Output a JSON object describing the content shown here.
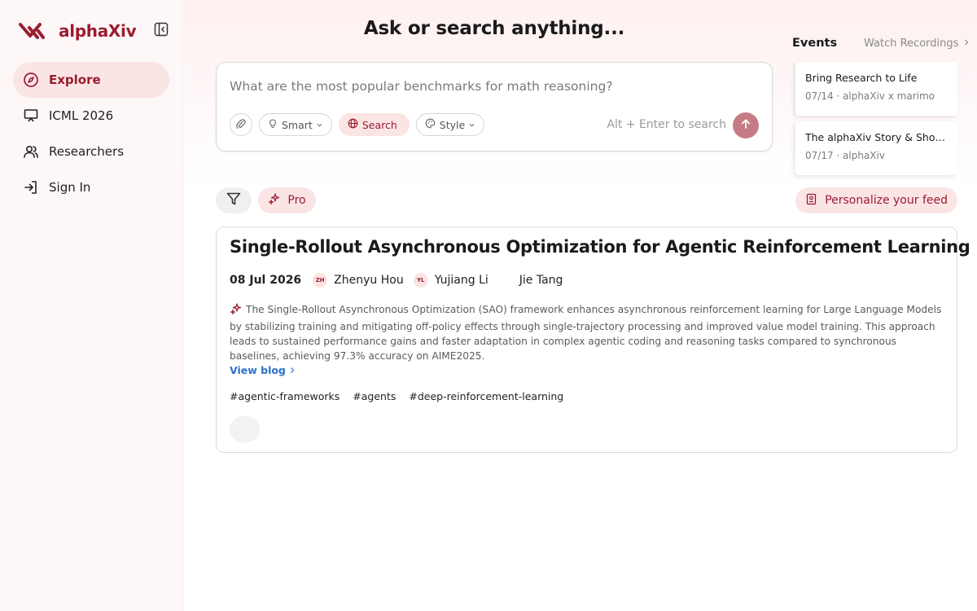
{
  "brand": {
    "name": "alphaXiv",
    "accent": "#9b1c31"
  },
  "sidebar": {
    "items": [
      {
        "label": "Explore",
        "icon": "compass-icon",
        "active": true
      },
      {
        "label": "ICML 2026",
        "icon": "presentation-icon"
      },
      {
        "label": "Researchers",
        "icon": "users-icon"
      },
      {
        "label": "Sign In",
        "icon": "sign-in-icon"
      }
    ]
  },
  "headline": "Ask or search anything...",
  "search": {
    "placeholder": "What are the most popular benchmarks for math reasoning?",
    "smart_label": "Smart",
    "search_label": "Search",
    "style_label": "Style",
    "hint": "Alt + Enter to search"
  },
  "events": {
    "title": "Events",
    "link_label": "Watch Recordings",
    "items": [
      {
        "title": "Bring Research to Life",
        "meta": "07/14 · alphaXiv x marimo"
      },
      {
        "title": "The alphaXiv Story & Showca...",
        "meta": "07/17 · alphaXiv"
      }
    ]
  },
  "toolbar": {
    "pro_label": "Pro",
    "personalize_label": "Personalize your feed"
  },
  "paper": {
    "title": "Single-Rollout Asynchronous Optimization for Agentic Reinforcement Learning",
    "date": "08 Jul 2026",
    "authors": [
      {
        "initials": "ZH",
        "name": "Zhenyu Hou"
      },
      {
        "initials": "YL",
        "name": "Yujiang Li"
      },
      {
        "initials": "",
        "name": "Jie Tang"
      }
    ],
    "summary": "The Single-Rollout Asynchronous Optimization (SAO) framework enhances asynchronous reinforcement learning for Large Language Models by stabilizing training and mitigating off-policy effects through single-trajectory processing and improved value model training. This approach leads to sustained performance gains and faster adaptation in complex agentic coding and reasoning tasks compared to synchronous baselines, achieving 97.3% accuracy on AIME2025.",
    "view_blog_label": "View blog",
    "tags": [
      "#agentic-frameworks",
      "#agents",
      "#deep-reinforcement-learning"
    ]
  }
}
